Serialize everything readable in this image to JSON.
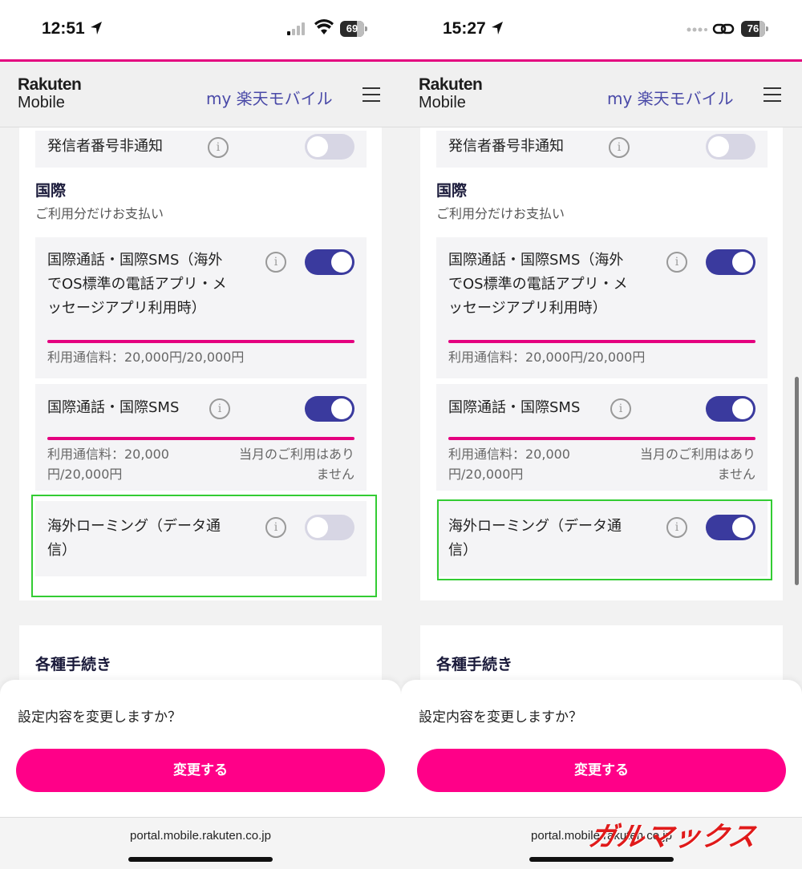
{
  "brand": {
    "line1": "Rakuten",
    "line2": "Mobile"
  },
  "header_title": "my 楽天モバイル",
  "colors": {
    "accent": "#e4007f",
    "toggle_on": "#3a3a9e",
    "toggle_off": "#d7d6e4",
    "highlight": "#33cc33",
    "button": "#ff0088"
  },
  "panels": [
    {
      "status": {
        "time": "12:51",
        "battery": "69",
        "connection": "wifi"
      },
      "caller_id_label": "発信者番号非通知",
      "caller_id_on": false,
      "section_title": "国際",
      "section_subtitle": "ご利用分だけお支払い",
      "intl_os": {
        "label_lines": [
          "国際通話・国際SMS（海外",
          "でOS標準の電話アプリ・メ",
          "ッセージアプリ利用時）"
        ],
        "on": true,
        "usage": 1.0,
        "fee": "利用通信料：20,000円/20,000円"
      },
      "intl_sms": {
        "label": "国際通話・国際SMS",
        "on": true,
        "usage": 1.0,
        "fee_lines": [
          "利用通信料：20,000",
          "円/20,000円"
        ],
        "note_lines": [
          "当月のご利用はあり",
          "ません"
        ]
      },
      "roaming": {
        "label_lines": [
          "海外ローミング（データ通",
          "信）"
        ],
        "on": false
      },
      "procedures_title": "各種手続き",
      "sheet": {
        "question": "設定内容を変更しますか？",
        "button": "変更する"
      },
      "url": "portal.mobile.rakuten.co.jp"
    },
    {
      "status": {
        "time": "15:27",
        "battery": "76",
        "connection": "link"
      },
      "caller_id_label": "発信者番号非通知",
      "caller_id_on": false,
      "section_title": "国際",
      "section_subtitle": "ご利用分だけお支払い",
      "intl_os": {
        "label_lines": [
          "国際通話・国際SMS（海外",
          "でOS標準の電話アプリ・メ",
          "ッセージアプリ利用時）"
        ],
        "on": true,
        "usage": 1.0,
        "fee": "利用通信料：20,000円/20,000円"
      },
      "intl_sms": {
        "label": "国際通話・国際SMS",
        "on": true,
        "usage": 1.0,
        "fee_lines": [
          "利用通信料：20,000",
          "円/20,000円"
        ],
        "note_lines": [
          "当月のご利用はあり",
          "ません"
        ]
      },
      "roaming": {
        "label_lines": [
          "海外ローミング（データ通",
          "信）"
        ],
        "on": true
      },
      "procedures_title": "各種手続き",
      "sheet": {
        "question": "設定内容を変更しますか？",
        "button": "変更する"
      },
      "url": "portal.mobile.rakuten.co.jp"
    }
  ],
  "watermark": "ガルマックス"
}
